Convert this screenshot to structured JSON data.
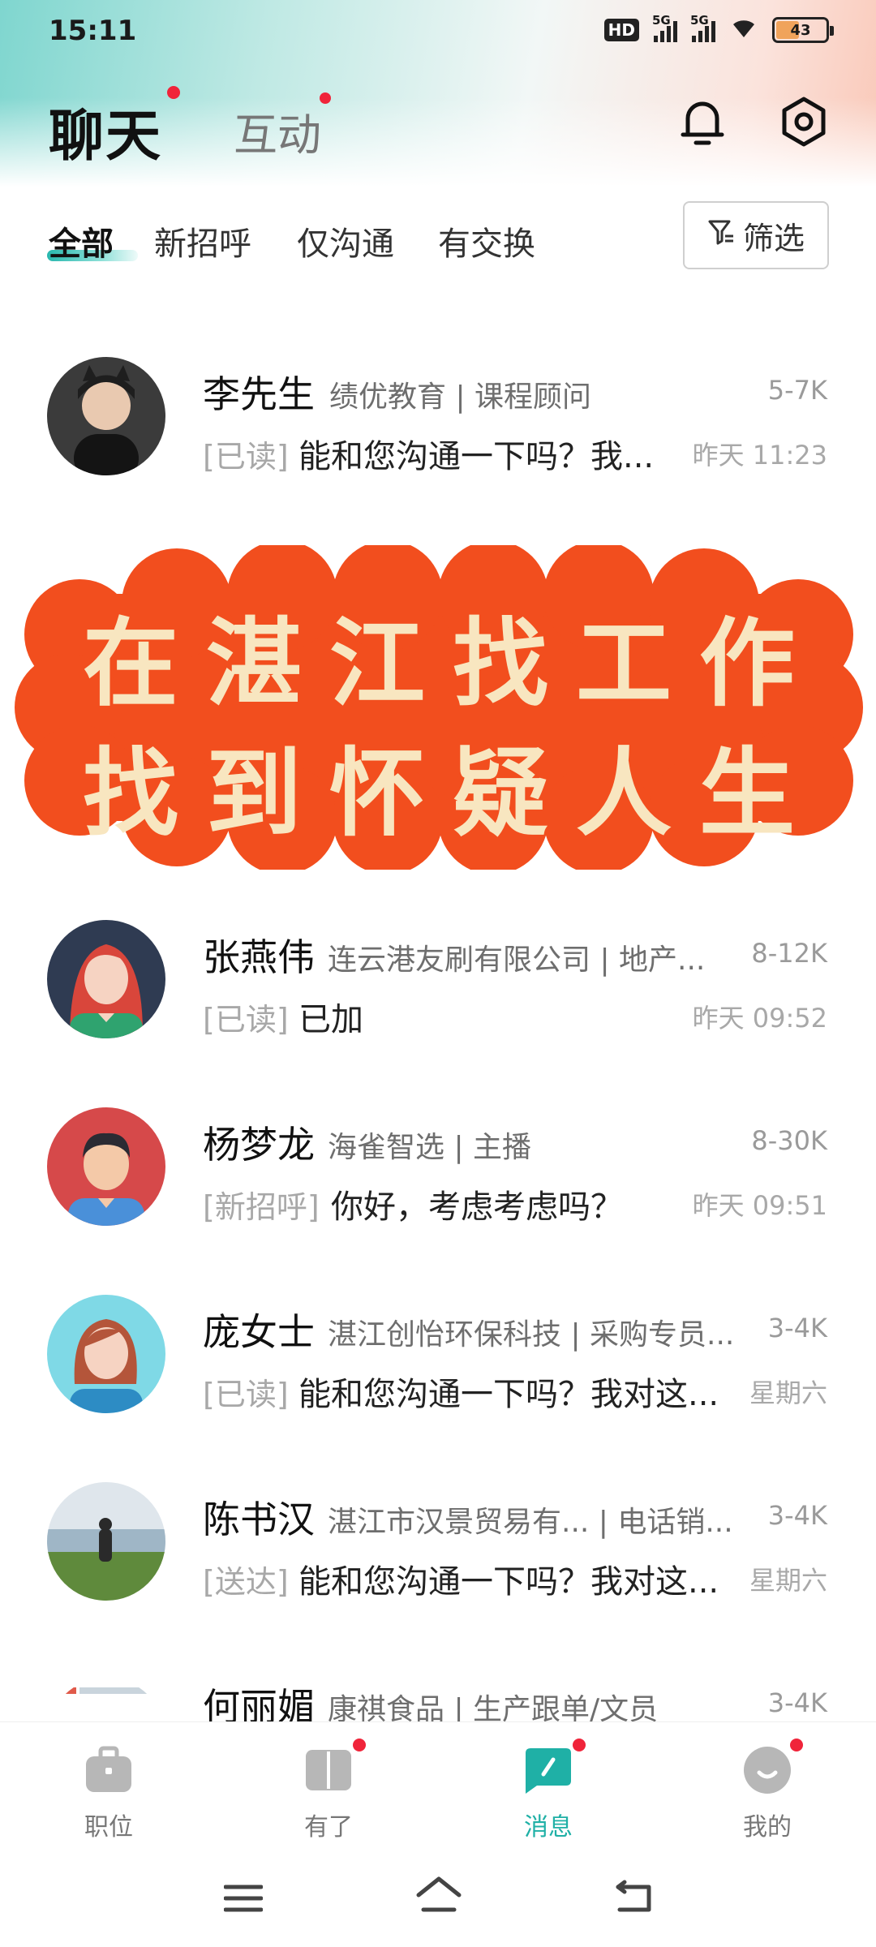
{
  "status_bar": {
    "time": "15:11",
    "hd_label": "HD",
    "sig1_label": "5G",
    "sig2_label": "5G",
    "battery": "43"
  },
  "header": {
    "tab_chat": "聊天",
    "tab_interact": "互动",
    "bell_icon": "bell-icon",
    "settings_icon": "gear-icon"
  },
  "filters": {
    "tabs": [
      "全部",
      "新招呼",
      "仅沟通",
      "有交换"
    ],
    "filter_button": "筛选"
  },
  "chats": [
    {
      "name": "李先生",
      "company": "绩优教育 | 课程顾问",
      "salary": "5-7K",
      "status": "[已读]",
      "message": "能和您沟通一下吗？我...",
      "time": "昨天 11:23"
    },
    {
      "name": "张燕伟",
      "company": "连云港友刷有限公司 | 地产...",
      "salary": "8-12K",
      "status": "[已读]",
      "message": "已加",
      "time": "昨天 09:52"
    },
    {
      "name": "杨梦龙",
      "company": "海雀智选 | 主播",
      "salary": "8-30K",
      "status": "[新招呼]",
      "message": "你好，考虑考虑吗？",
      "time": "昨天 09:51"
    },
    {
      "name": "庞女士",
      "company": "湛江创怡环保科技 | 采购专员...",
      "salary": "3-4K",
      "status": "[已读]",
      "message": "能和您沟通一下吗？我对这...",
      "time": "星期六"
    },
    {
      "name": "陈书汉",
      "company": "湛江市汉景贸易有... | 电话销...",
      "salary": "3-4K",
      "status": "[送达]",
      "message": "能和您沟通一下吗？我对这...",
      "time": "星期六"
    },
    {
      "name": "何丽媚",
      "company": "康祺食品 | 生产跟单/文员",
      "salary": "3-4K"
    }
  ],
  "banner": {
    "line1": "在湛江找工作",
    "line2": "找到怀疑人生",
    "color": "#f24e1e"
  },
  "bottom_nav": {
    "items": [
      "职位",
      "有了",
      "消息",
      "我的"
    ],
    "accent": "#1fb0a6"
  }
}
